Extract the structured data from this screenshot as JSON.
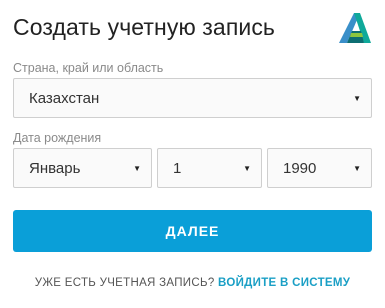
{
  "header": {
    "title": "Создать учетную запись",
    "logo_icon": "autodesk-logo-icon",
    "logo_colors": [
      "#0fa99a",
      "#3a8fc9",
      "#8cc63f",
      "#0d6e72"
    ]
  },
  "country": {
    "label": "Страна, край или область",
    "value": "Казахстан"
  },
  "dob": {
    "label": "Дата рождения",
    "month": "Январь",
    "day": "1",
    "year": "1990"
  },
  "caret_glyph": "▼",
  "next_button": {
    "label": "ДАЛЕЕ",
    "color": "#0a9fd8"
  },
  "footer": {
    "question": "УЖЕ ЕСТЬ УЧЕТНАЯ ЗАПИСЬ?",
    "link": "ВОЙДИТЕ В СИСТЕМУ",
    "link_color": "#1a9fc5"
  }
}
